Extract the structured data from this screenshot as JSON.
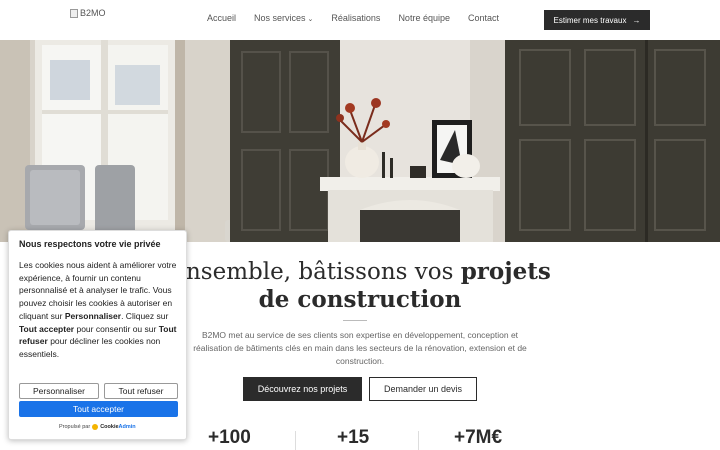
{
  "header": {
    "logo_alt": "B2MO",
    "nav": [
      {
        "label": "Accueil"
      },
      {
        "label": "Nos services"
      },
      {
        "label": "Réalisations"
      },
      {
        "label": "Notre équipe"
      },
      {
        "label": "Contact"
      }
    ],
    "cta_label": "Estimer mes travaux",
    "cta_icon": "arrow-right-icon",
    "dropdown_icon": "chevron-down-icon"
  },
  "hero": {
    "image_alt": "",
    "title_part1": "Ensemble, bâtissons vos ",
    "title_bold1": "projets",
    "title_bold2": "de construction",
    "description": "B2MO met au service de ses clients son expertise en développement, conception et réalisation de bâtiments clés en main dans les secteurs de la rénovation, extension et de construction.",
    "primary_button": "Découvrez nos projets",
    "secondary_button": "Demander un devis"
  },
  "stats": [
    {
      "value": "+100"
    },
    {
      "value": "+15"
    },
    {
      "value": "+7M€"
    }
  ],
  "cookie_banner": {
    "title": "Nous respectons votre vie privée",
    "text_1": "Les cookies nous aident à améliorer votre expérience, à fournir un contenu personnalisé et à analyser le trafic. Vous pouvez choisir les cookies à autoriser en cliquant sur ",
    "bold_1": "Personnaliser",
    "text_2": ". Cliquez sur ",
    "bold_2": "Tout accepter",
    "text_3": " pour consentir ou sur ",
    "bold_3": "Tout refuser",
    "text_4": " pour décliner les cookies non essentiels.",
    "customize_button": "Personnaliser",
    "reject_button": "Tout refuser",
    "accept_button": "Tout accepter",
    "powered_by": "Propulsé par",
    "brand_a": "Cookie",
    "brand_b": "Admin"
  },
  "colors": {
    "dark": "#2b2b2b",
    "accept_blue": "#1a73e8"
  }
}
